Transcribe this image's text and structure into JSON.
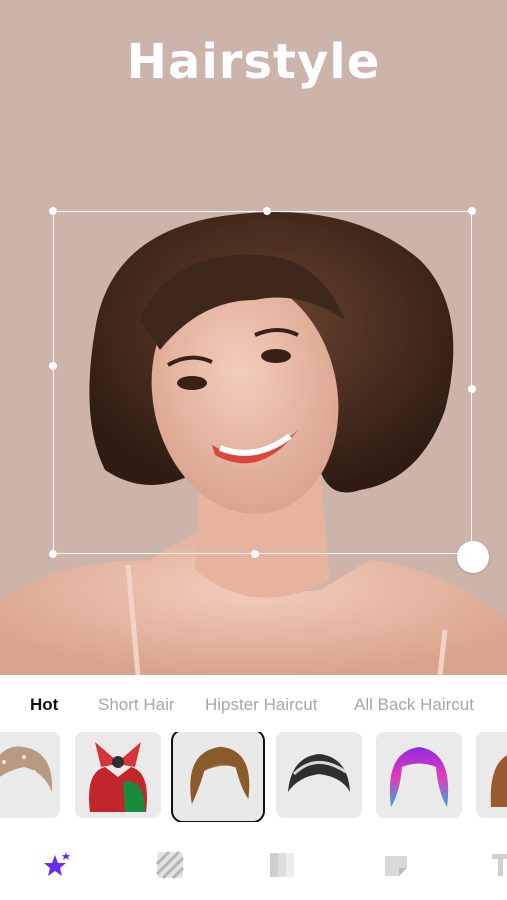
{
  "header": {
    "title": "Hairstyle"
  },
  "tabs": [
    {
      "label": "Hot",
      "active": true
    },
    {
      "label": "Short Hair",
      "active": false
    },
    {
      "label": "Hipster Haircut",
      "active": false
    },
    {
      "label": "All Back Haircut",
      "active": false
    }
  ],
  "thumbnails": [
    {
      "name": "glitter-wig"
    },
    {
      "name": "bow-wig-red-green"
    },
    {
      "name": "brown-bob-wig",
      "selected": true
    },
    {
      "name": "silver-short-wig"
    },
    {
      "name": "rainbow-bob-wig"
    },
    {
      "name": "partial-wig"
    }
  ],
  "toolbar": {
    "icons": [
      "sticker-star-icon",
      "pattern-icon",
      "gradient-icon",
      "fold-sticker-icon",
      "text-icon"
    ],
    "accent": "#6a2cf0"
  }
}
